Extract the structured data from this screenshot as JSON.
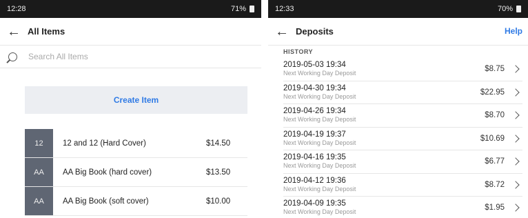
{
  "left": {
    "status": {
      "time": "12:28",
      "right": "71%"
    },
    "title": "All Items",
    "search_placeholder": "Search All Items",
    "create_label": "Create Item",
    "items": [
      {
        "badge": "12",
        "name": "12 and 12 (Hard Cover)",
        "price": "$14.50"
      },
      {
        "badge": "AA",
        "name": "AA Big Book (hard cover)",
        "price": "$13.50"
      },
      {
        "badge": "AA",
        "name": "AA Big Book (soft cover)",
        "price": "$10.00"
      }
    ]
  },
  "right": {
    "status": {
      "time": "12:33",
      "right": "70%"
    },
    "title": "Deposits",
    "help_label": "Help",
    "history_label": "HISTORY",
    "deposits": [
      {
        "date": "2019-05-03 19:34",
        "type": "Next Working Day Deposit",
        "amount": "$8.75"
      },
      {
        "date": "2019-04-30 19:34",
        "type": "Next Working Day Deposit",
        "amount": "$22.95"
      },
      {
        "date": "2019-04-26 19:34",
        "type": "Next Working Day Deposit",
        "amount": "$8.70"
      },
      {
        "date": "2019-04-19 19:37",
        "type": "Next Working Day Deposit",
        "amount": "$10.69"
      },
      {
        "date": "2019-04-16 19:35",
        "type": "Next Working Day Deposit",
        "amount": "$6.77"
      },
      {
        "date": "2019-04-12 19:36",
        "type": "Next Working Day Deposit",
        "amount": "$8.72"
      },
      {
        "date": "2019-04-09 19:35",
        "type": "Next Working Day Deposit",
        "amount": "$1.95"
      }
    ]
  },
  "colors": {
    "accent": "#2f7ae5",
    "badge": "#5f6673",
    "statusbar": "#1a1a1a"
  }
}
